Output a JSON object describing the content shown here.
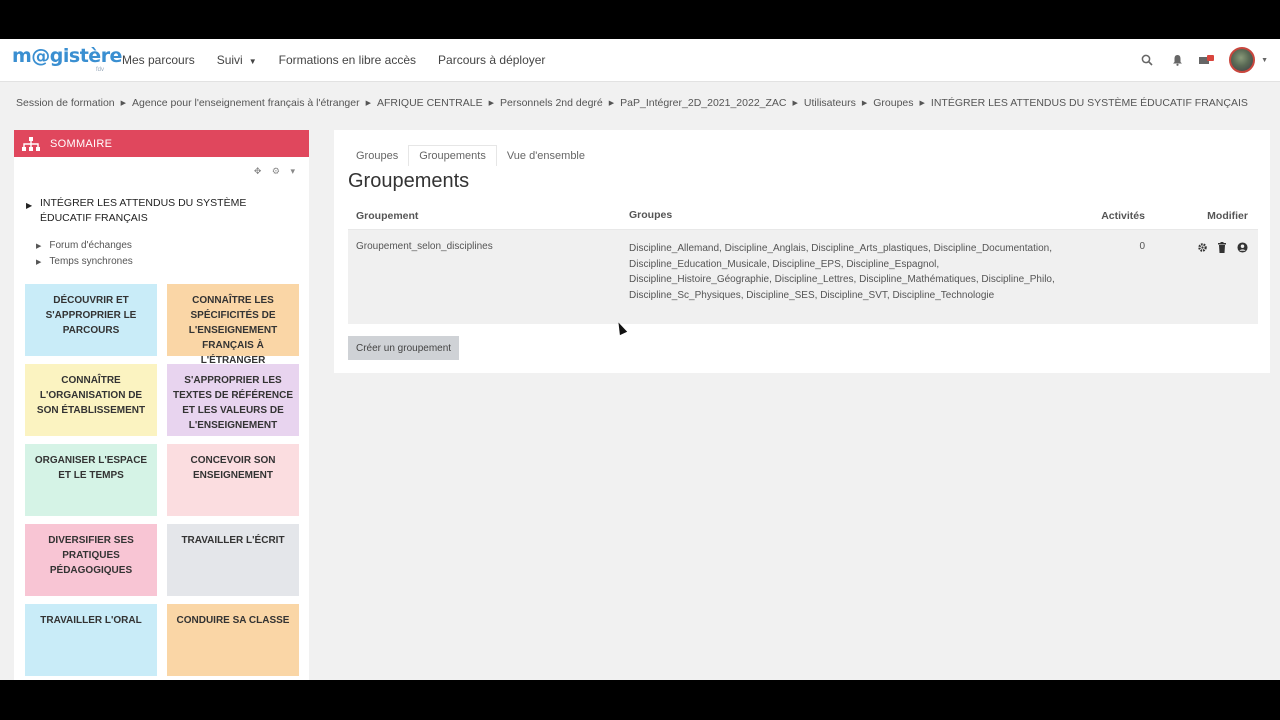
{
  "navbar": {
    "logo": "m@gistère",
    "logo_sub": "fdv",
    "links": [
      {
        "label": "Mes parcours"
      },
      {
        "label": "Suivi",
        "caret": "▼"
      },
      {
        "label": "Formations en libre accès"
      },
      {
        "label": "Parcours à déployer"
      }
    ],
    "icons": [
      "search-icon",
      "bell-icon",
      "messages-icon"
    ],
    "avatar_caret": "▼"
  },
  "breadcrumb": [
    "Session de formation",
    "Agence pour l'enseignement français à l'étranger",
    "AFRIQUE CENTRALE",
    "Personnels 2nd degré",
    "PaP_Intégrer_2D_2021_2022_ZAC",
    "Utilisateurs",
    "Groupes",
    "INTÉGRER LES ATTENDUS DU SYSTÈME ÉDUCATIF FRANÇAIS"
  ],
  "breadcrumb_sep": "▶",
  "sidebar": {
    "title": "SOMMAIRE",
    "tools": "✥ ⚙ ▾",
    "section_title": "INTÉGRER LES ATTENDUS DU SYSTÈME ÉDUCATIF FRANÇAIS",
    "sub_links": [
      "Forum d'échanges",
      "Temps synchrones"
    ],
    "tiles": [
      {
        "label": "DÉCOUVRIR ET S'APPROPRIER LE PARCOURS",
        "color": "#c9ecf8"
      },
      {
        "label": "CONNAÎTRE LES SPÉCIFICITÉS DE L'ENSEIGNEMENT FRANÇAIS À L'ÉTRANGER",
        "color": "#fad6a6"
      },
      {
        "label": "CONNAÎTRE L'ORGANISATION DE SON ÉTABLISSEMENT",
        "color": "#fbf3c1"
      },
      {
        "label": "S'APPROPRIER LES TEXTES DE RÉFÉRENCE ET LES VALEURS DE L'ENSEIGNEMENT",
        "color": "#e8d4ef"
      },
      {
        "label": "ORGANISER L'ESPACE ET LE TEMPS",
        "color": "#d5f3e6"
      },
      {
        "label": "CONCEVOIR SON ENSEIGNEMENT",
        "color": "#fbdde0"
      },
      {
        "label": "DIVERSIFIER SES PRATIQUES PÉDAGOGIQUES",
        "color": "#f8c5d4"
      },
      {
        "label": "TRAVAILLER L'ÉCRIT",
        "color": "#e4e6ea"
      },
      {
        "label": "TRAVAILLER L'ORAL",
        "color": "#c9ecf8"
      },
      {
        "label": "CONDUIRE SA CLASSE",
        "color": "#fad6a6"
      }
    ]
  },
  "main": {
    "tabs": [
      {
        "label": "Groupes",
        "active": false
      },
      {
        "label": "Groupements",
        "active": true
      },
      {
        "label": "Vue d'ensemble",
        "active": false
      }
    ],
    "title": "Groupements",
    "table": {
      "headers": {
        "groupement": "Groupement",
        "groupes": "Groupes",
        "activites": "Activités",
        "modifier": "Modifier"
      },
      "rows": [
        {
          "groupement": "Groupement_selon_disciplines",
          "groupes": "Discipline_Allemand, Discipline_Anglais, Discipline_Arts_plastiques, Discipline_Documentation, Discipline_Education_Musicale, Discipline_EPS, Discipline_Espagnol, Discipline_Histoire_Géographie, Discipline_Lettres, Discipline_Mathématiques, Discipline_Philo, Discipline_Sc_Physiques, Discipline_SES, Discipline_SVT, Discipline_Technologie",
          "activites": "0"
        }
      ]
    },
    "create_button": "Créer un groupement"
  }
}
